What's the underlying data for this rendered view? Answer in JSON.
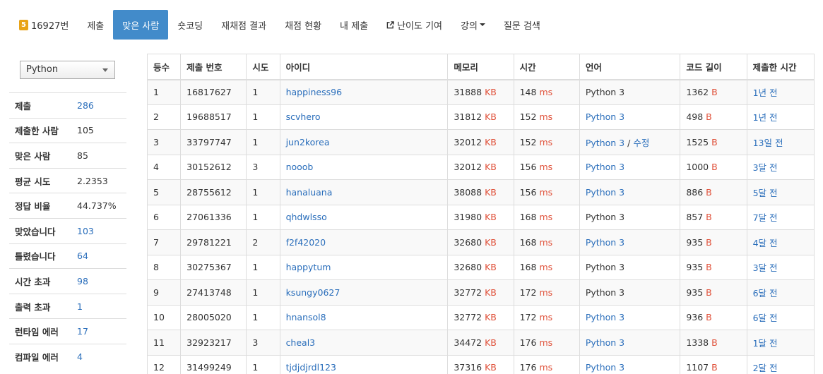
{
  "nav": {
    "problem_label": "16927번",
    "problem_badge": "5",
    "items": [
      {
        "label": "제출"
      },
      {
        "label": "맞은 사람"
      },
      {
        "label": "숏코딩"
      },
      {
        "label": "재채점 결과"
      },
      {
        "label": "채점 현황"
      },
      {
        "label": "내 제출"
      },
      {
        "label": "난이도 기여"
      },
      {
        "label": "강의"
      },
      {
        "label": "질문 검색"
      }
    ]
  },
  "sidebar": {
    "language_select": "Python",
    "stats": [
      {
        "label": "제출",
        "value": "286"
      },
      {
        "label": "제출한 사람",
        "value": "105"
      },
      {
        "label": "맞은 사람",
        "value": "85"
      },
      {
        "label": "평균 시도",
        "value": "2.2353"
      },
      {
        "label": "정답 비율",
        "value": "44.737%"
      },
      {
        "label": "맞았습니다",
        "value": "103"
      },
      {
        "label": "틀렸습니다",
        "value": "64"
      },
      {
        "label": "시간 초과",
        "value": "98"
      },
      {
        "label": "출력 초과",
        "value": "1"
      },
      {
        "label": "런타임 에러",
        "value": "17"
      },
      {
        "label": "컴파일 에러",
        "value": "4"
      }
    ]
  },
  "table": {
    "headers": [
      "등수",
      "제출 번호",
      "시도",
      "아이디",
      "메모리",
      "시간",
      "언어",
      "코드 길이",
      "제출한 시간"
    ],
    "units": {
      "memory": "KB",
      "time": "ms",
      "length": "B"
    },
    "edit_label": "수정",
    "rows": [
      {
        "rank": "1",
        "id": "16817627",
        "try": "1",
        "user": "happiness96",
        "mem": "31888",
        "time": "148",
        "lang": "Python 3",
        "len": "1362",
        "ago": "1년 전"
      },
      {
        "rank": "2",
        "id": "19688517",
        "try": "1",
        "user": "scvhero",
        "mem": "31812",
        "time": "152",
        "lang": "Python 3",
        "len": "498",
        "ago": "1년 전"
      },
      {
        "rank": "3",
        "id": "33797747",
        "try": "1",
        "user": "jun2korea",
        "mem": "32012",
        "time": "152",
        "lang": "Python 3",
        "len": "1525",
        "ago": "13일 전"
      },
      {
        "rank": "4",
        "id": "30152612",
        "try": "3",
        "user": "nooob",
        "mem": "32012",
        "time": "156",
        "lang": "Python 3",
        "len": "1000",
        "ago": "3달 전"
      },
      {
        "rank": "5",
        "id": "28755612",
        "try": "1",
        "user": "hanaluana",
        "mem": "38088",
        "time": "156",
        "lang": "Python 3",
        "len": "886",
        "ago": "5달 전"
      },
      {
        "rank": "6",
        "id": "27061336",
        "try": "1",
        "user": "qhdwlsso",
        "mem": "31980",
        "time": "168",
        "lang": "Python 3",
        "len": "857",
        "ago": "7달 전"
      },
      {
        "rank": "7",
        "id": "29781221",
        "try": "2",
        "user": "f2f42020",
        "mem": "32680",
        "time": "168",
        "lang": "Python 3",
        "len": "935",
        "ago": "4달 전"
      },
      {
        "rank": "8",
        "id": "30275367",
        "try": "1",
        "user": "happytum",
        "mem": "32680",
        "time": "168",
        "lang": "Python 3",
        "len": "935",
        "ago": "3달 전"
      },
      {
        "rank": "9",
        "id": "27413748",
        "try": "1",
        "user": "ksungy0627",
        "mem": "32772",
        "time": "172",
        "lang": "Python 3",
        "len": "935",
        "ago": "6달 전"
      },
      {
        "rank": "10",
        "id": "28005020",
        "try": "1",
        "user": "hnansol8",
        "mem": "32772",
        "time": "172",
        "lang": "Python 3",
        "len": "936",
        "ago": "6달 전"
      },
      {
        "rank": "11",
        "id": "32923217",
        "try": "3",
        "user": "cheal3",
        "mem": "34472",
        "time": "176",
        "lang": "Python 3",
        "len": "1338",
        "ago": "1달 전"
      },
      {
        "rank": "12",
        "id": "31499249",
        "try": "1",
        "user": "tjdjdjrdl123",
        "mem": "37316",
        "time": "176",
        "lang": "Python 3",
        "len": "1107",
        "ago": "2달 전"
      }
    ]
  }
}
